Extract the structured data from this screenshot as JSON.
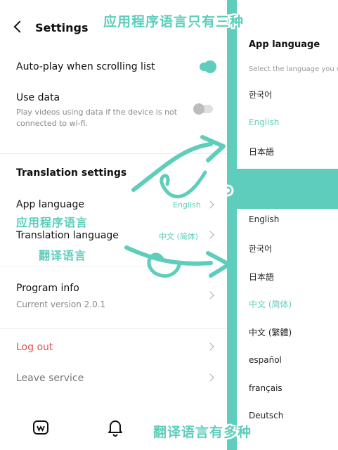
{
  "header": {
    "title": "Settings"
  },
  "playback": {
    "autoplay_label": "Auto-play when scrolling list",
    "use_data_label": "Use data",
    "use_data_desc": "Play videos using data if the device is not connected to wi-fi."
  },
  "translation": {
    "section_title": "Translation settings",
    "app_language_label": "App language",
    "app_language_value": "English",
    "translation_language_label": "Translation language",
    "translation_language_value": "中文 (简体)"
  },
  "program": {
    "label": "Program info",
    "version": "Current version 2.0.1"
  },
  "account": {
    "logout_label": "Log out",
    "leave_label": "Leave service"
  },
  "app_language_panel": {
    "title": "App language",
    "subtitle": "Select the language you w",
    "options": [
      "한국어",
      "English",
      "日本語"
    ],
    "selected": "English"
  },
  "translation_language_panel": {
    "options": [
      "English",
      "한국어",
      "日本語",
      "中文 (简体)",
      "中文 (繁體)",
      "español",
      "français",
      "Deutsch"
    ],
    "selected": "中文 (简体)"
  },
  "annotations": {
    "top": "应用程序语言只有三种",
    "app_language_cn": "应用程序语言",
    "translation_language_cn": "翻译语言",
    "bottom": "翻译语言有多种"
  },
  "colors": {
    "accent": "#5ecdbb",
    "logout": "#d9534f",
    "muted_text": "#888888"
  },
  "icons": [
    "back-icon",
    "toggle-on",
    "toggle-off",
    "chevron-right-icon",
    "home-icon",
    "bell-icon"
  ]
}
